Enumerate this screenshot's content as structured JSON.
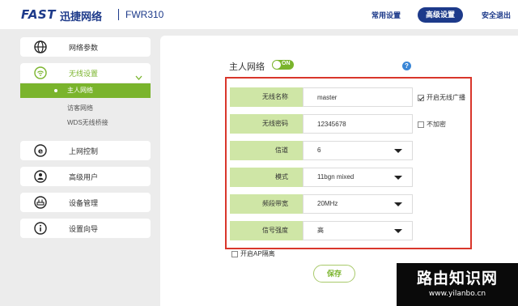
{
  "header": {
    "logo": "FAST",
    "brand": "迅捷网络",
    "model": "FWR310",
    "nav": {
      "basic": "常用设置",
      "advanced": "高级设置",
      "logout": "安全退出"
    }
  },
  "sidebar": {
    "network_params": "网络参数",
    "wireless": {
      "label": "无线设置",
      "sub": [
        "主人网络",
        "访客网络",
        "WDS无线桥接"
      ]
    },
    "internet_control": "上网控制",
    "advanced_users": "高级用户",
    "device_mgmt": "设备管理",
    "setup_wizard": "设置向导"
  },
  "main": {
    "title": "主人网络",
    "toggle": "ON",
    "help": "?",
    "rows": [
      {
        "label": "无线名称",
        "value": "master"
      },
      {
        "label": "无线密码",
        "value": "12345678"
      },
      {
        "label": "信道",
        "value": "6"
      },
      {
        "label": "模式",
        "value": "11bgn mixed"
      },
      {
        "label": "频段带宽",
        "value": "20MHz"
      },
      {
        "label": "信号强度",
        "value": "高"
      }
    ],
    "broadcast_label": "开启无线广播",
    "no_encrypt_label": "不加密",
    "ap_isolation_label": "开启AP隔离",
    "save": "保存"
  },
  "watermark": {
    "line1": "路由知识网",
    "line2": "www.yilanbo.cn"
  },
  "colors": {
    "brand_blue": "#1d3a8a",
    "accent_green": "#7ab42c",
    "label_green": "#cfe6a6",
    "highlight_red": "#d9362b"
  }
}
